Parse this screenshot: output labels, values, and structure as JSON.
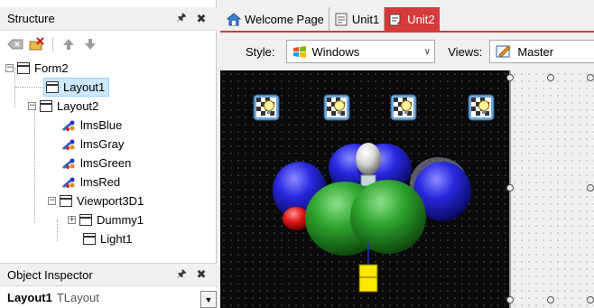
{
  "structure_panel": {
    "title": "Structure",
    "tree": [
      {
        "label": "Form2",
        "icon": "form-icon",
        "expander": "−"
      },
      {
        "label": "Layout1",
        "icon": "layout-icon",
        "selected": true
      },
      {
        "label": "Layout2",
        "icon": "layout-icon",
        "expander": "−"
      },
      {
        "label": "lmsBlue",
        "icon": "material-source-icon"
      },
      {
        "label": "lmsGray",
        "icon": "material-source-icon"
      },
      {
        "label": "lmsGreen",
        "icon": "material-source-icon"
      },
      {
        "label": "lmsRed",
        "icon": "material-source-icon"
      },
      {
        "label": "Viewport3D1",
        "icon": "viewport-icon",
        "expander": "−"
      },
      {
        "label": "Dummy1",
        "icon": "dummy-icon",
        "expander": "+"
      },
      {
        "label": "Light1",
        "icon": "light-icon"
      }
    ]
  },
  "object_inspector": {
    "title": "Object Inspector",
    "selected_name": "Layout1",
    "selected_type": "TLayout"
  },
  "tabs": [
    {
      "label": "Welcome Page",
      "icon": "home-icon",
      "active": false
    },
    {
      "label": "Unit1",
      "icon": "unit-icon",
      "active": false
    },
    {
      "label": "Unit2",
      "icon": "unit-edit-icon",
      "active": true
    }
  ],
  "stylebar": {
    "style_label": "Style:",
    "style_value": "Windows",
    "views_label": "Views:",
    "views_value": "Master"
  },
  "colors": {
    "accent": "#d63a3a",
    "selection": "#cde8ff",
    "blue_sphere": "#2828e0",
    "green_sphere": "#2ea32e",
    "red_sphere": "#e01818",
    "gray_sphere": "#d8d8d8",
    "yellow_cube": "#ffe800"
  }
}
